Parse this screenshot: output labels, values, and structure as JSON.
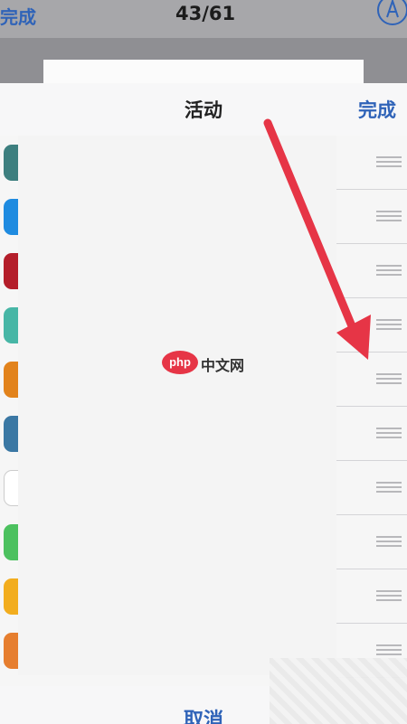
{
  "top_bar": {
    "done_label": "完成",
    "counter": "43/61",
    "markup_icon": "markup-pen-icon"
  },
  "panel": {
    "title": "活动",
    "done_label": "完成"
  },
  "apps": [
    {
      "name": "",
      "icon": "app-icon",
      "color": "#3d7f7f"
    },
    {
      "name": "",
      "icon": "app-icon",
      "color": "#1f8be0"
    },
    {
      "name": "",
      "icon": "app-icon",
      "color": "#b41e2a"
    },
    {
      "name": "",
      "icon": "app-icon",
      "color": "#47b6a6"
    },
    {
      "name": "",
      "icon": "app-icon",
      "color": "#e2831c"
    },
    {
      "name": "",
      "icon": "app-icon",
      "color": "#3b78a4"
    },
    {
      "name": "",
      "icon": "app-icon",
      "color": "#ffffff"
    },
    {
      "name": "",
      "icon": "app-icon",
      "color": "#4cc15f"
    },
    {
      "name": "",
      "icon": "app-icon",
      "color": "#f2ad1e"
    },
    {
      "name": "",
      "icon": "app-icon",
      "color": "#e67e2f"
    }
  ],
  "watermark": {
    "logo_text": "php",
    "site_text": "中文网"
  },
  "bottom": {
    "cancel_label": "取消"
  },
  "colors": {
    "accent": "#2f63b8",
    "arrow": "#e63546"
  }
}
